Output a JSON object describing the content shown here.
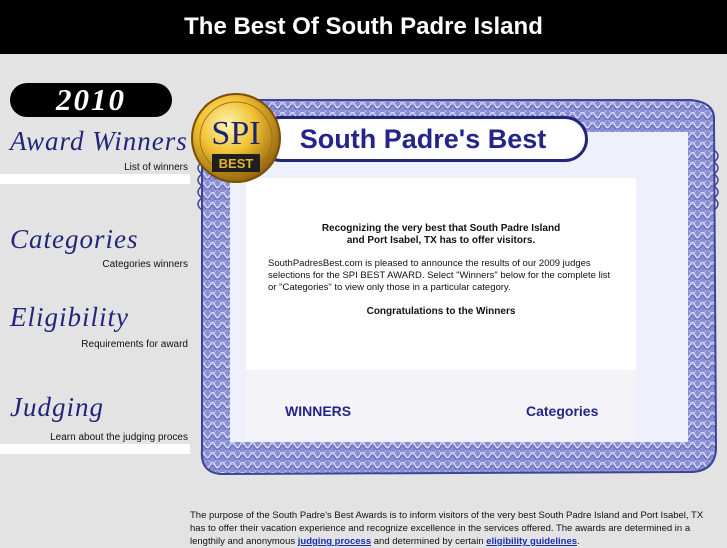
{
  "header": {
    "title": "The Best Of South Padre Island"
  },
  "sidebar": {
    "year": "2010",
    "sections": [
      {
        "title": "Award Winners",
        "desc": "List of winners"
      },
      {
        "title": "Categories",
        "desc": "Categories winners"
      },
      {
        "title": "Eligibility",
        "desc": "Requirements for award"
      },
      {
        "title": "Judging",
        "desc": "Learn about the judging proces"
      }
    ]
  },
  "certificate": {
    "title": "South Padre's Best",
    "headline_line1": "Recognizing the very best that South Padre Island",
    "headline_line2": "and Port Isabel, TX has to offer visitors.",
    "intro": "SouthPadresBest.com is pleased to announce the results of our 2009 judges selections for the SPI BEST AWARD.  Select \"Winners\" below for the complete list or \"Categories\" to view only those in a particular category.",
    "congrats": "Congratulations to the Winners",
    "winners_link": "WINNERS",
    "categories_link": "Categories",
    "seal_top": "SPI",
    "seal_bottom": "BEST"
  },
  "footer": {
    "text_part1": "The purpose of the South Padre's Best Awards is to inform visitors of the very best South Padre Island and Port Isabel, TX has to offer their vacation experience and recognize excellence in the services offered. The awards are determined in a lengthily and anonymous ",
    "judging_link": "judging process",
    "text_part2": " and determined by certain ",
    "eligibility_link": "eligibility guidelines",
    "text_part3": "."
  },
  "colors": {
    "accent": "#23258a",
    "border": "#6a6fc0",
    "gold": "#d9a520"
  }
}
